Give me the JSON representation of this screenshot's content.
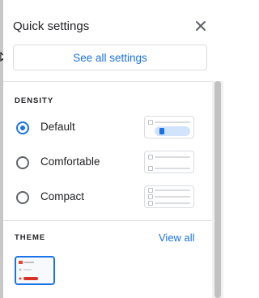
{
  "header": {
    "title": "Quick settings",
    "close_icon": "close-icon",
    "see_all_label": "See all settings"
  },
  "density": {
    "heading": "DENSITY",
    "options": [
      {
        "label": "Default",
        "selected": true,
        "preview_icon": "default-density-preview-icon"
      },
      {
        "label": "Comfortable",
        "selected": false,
        "preview_icon": "comfortable-density-preview-icon"
      },
      {
        "label": "Compact",
        "selected": false,
        "preview_icon": "compact-density-preview-icon"
      }
    ]
  },
  "theme": {
    "heading": "THEME",
    "view_all_label": "View all",
    "thumbnail_icon": "gmail-theme-thumbnail-icon"
  },
  "colors": {
    "accent": "#1a73e8",
    "text": "#202124",
    "border": "#dadce0"
  }
}
